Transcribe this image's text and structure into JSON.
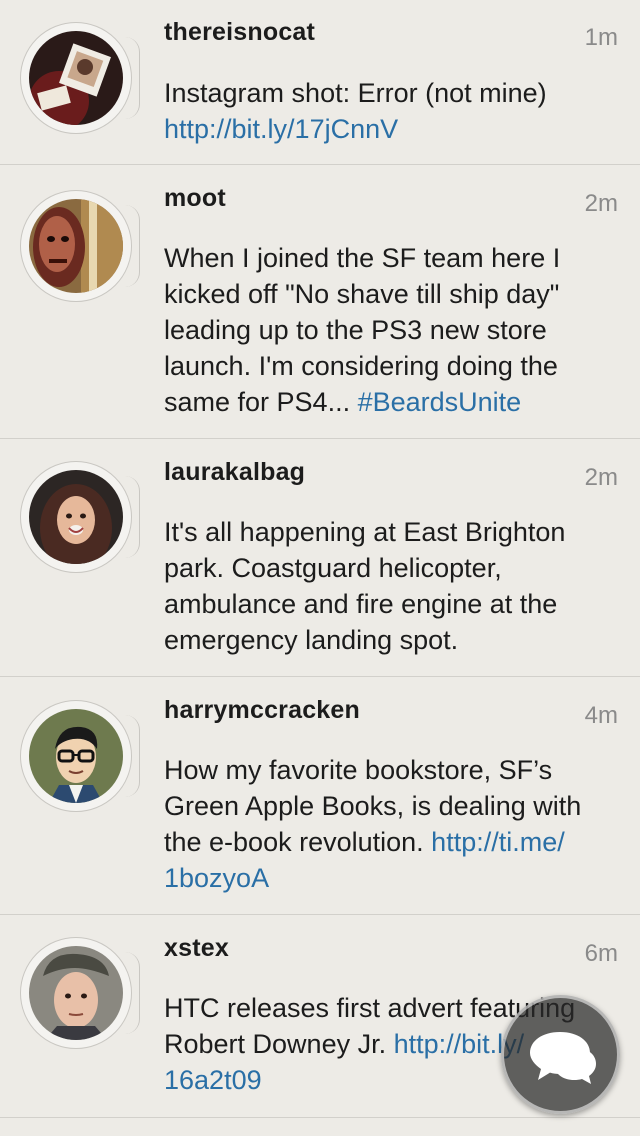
{
  "tweets": [
    {
      "username": "thereisnocat",
      "time": "1m",
      "text_parts": [
        "Instagram shot: Error (not mine)"
      ],
      "link": "http://bit.ly/17jCnnV"
    },
    {
      "username": "moot",
      "time": "2m",
      "text_parts": [
        "When I joined the SF team here I",
        "kicked off \"No shave till ship day\"",
        "leading up to the PS3 new store",
        "launch. I'm considering doing the",
        "same for PS4... "
      ],
      "link": "#BeardsUnite"
    },
    {
      "username": "laurakalbag",
      "time": "2m",
      "text_parts": [
        "It's all happening at East Brighton",
        "park. Coastguard helicopter,",
        "ambulance and fire engine at the",
        "emergency landing spot."
      ]
    },
    {
      "username": "harrymccracken",
      "time": "4m",
      "text_parts": [
        "How my favorite bookstore, SF’s",
        "Green Apple Books, is dealing with",
        "the e-book revolution. "
      ],
      "link_a": "http://ti.me/",
      "link_b": "1bozyoA"
    },
    {
      "username": "xstex",
      "time": "6m",
      "text_parts": [
        "HTC releases first advert featuring",
        "Robert Downey Jr. "
      ],
      "link_a": "http://bit.ly/",
      "link_b": "16a2t09"
    }
  ],
  "compose": {
    "icon": "chat-bubbles-icon"
  },
  "colors": {
    "background": "#edebe6",
    "link": "#2a6fa6",
    "text": "#1c1c1c",
    "timestamp": "#8a8a8a"
  }
}
